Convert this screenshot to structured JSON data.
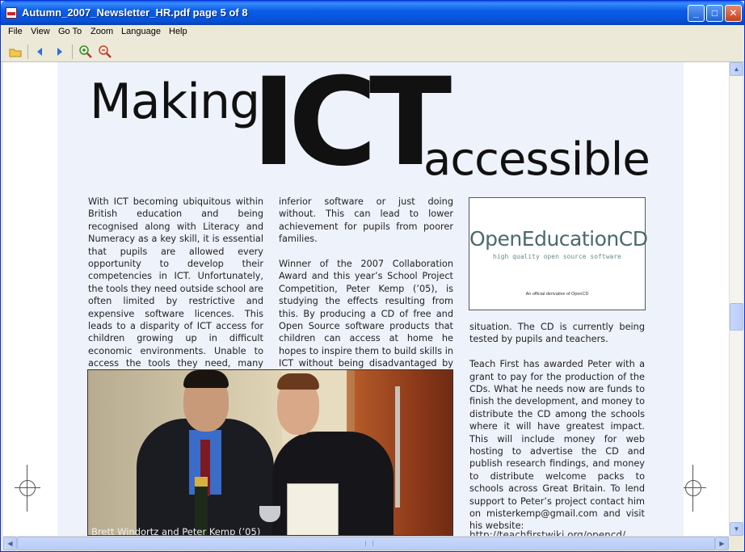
{
  "window": {
    "title": "Autumn_2007_Newsletter_HR.pdf page 5 of 8",
    "controls": {
      "minimize": "_",
      "maximize": "□",
      "close": "✕"
    }
  },
  "menu": {
    "items": [
      "File",
      "View",
      "Go To",
      "Zoom",
      "Language",
      "Help"
    ]
  },
  "toolbar": {
    "icons": [
      "open-folder-icon",
      "previous-page-icon",
      "next-page-icon",
      "zoom-in-icon",
      "zoom-out-icon"
    ]
  },
  "document": {
    "headline": {
      "making": "Making",
      "ict": "ICT",
      "accessible": "accessible"
    },
    "column1": "With ICT becoming ubiquitous within British education and being recognised along with Literacy and Numeracy as a key skill, it is essential that pupils are allowed every opportunity to develop their competencies in ICT. Unfortunately, the tools they need outside school are often limited by restrictive and expensive software licences.  This leads to a disparity of ICT access for children growing up in difficult economic environments. Unable to access the tools they need, many children choose piracy,",
    "column2": {
      "p1": "inferior software or just doing without. This can lead to lower achievement for pupils from poorer families.",
      "p2": "Winner of the 2007 Collaboration Award and this year’s School Project Competition, Peter Kemp (’05), is studying the effects resulting from this. By producing a CD of free and Open Source software products that children can access at home he hopes to inspire them to build skills in ICT without being disadvantaged by their economic"
    },
    "logo": {
      "title": "OpenEducationCD",
      "subtitle": "high quality open source software",
      "footer": "An official derivative of OpenCD"
    },
    "column3": {
      "p1": "situation. The CD is currently being tested by pupils and teachers.",
      "p2": "Teach First has awarded Peter with a grant to pay for the production of the CDs. What he needs now are funds to finish the development, and money to distribute the CD among the schools where it will have greatest impact.  This will include money for web hosting to advertise the CD and publish research findings, and money to distribute welcome packs to schools across Great Britain.  To lend support to Peter’s project contact him on misterkemp@gmail.com and visit his website:"
    },
    "url_fragment": "http://teachfirstwiki.org/opencd/",
    "photo_caption": "Brett Windortz and Peter Kemp (’05)"
  },
  "colors": {
    "titlebar": "#0a5ee8",
    "page_bg": "#eef2fa",
    "chrome": "#ece9d8"
  }
}
